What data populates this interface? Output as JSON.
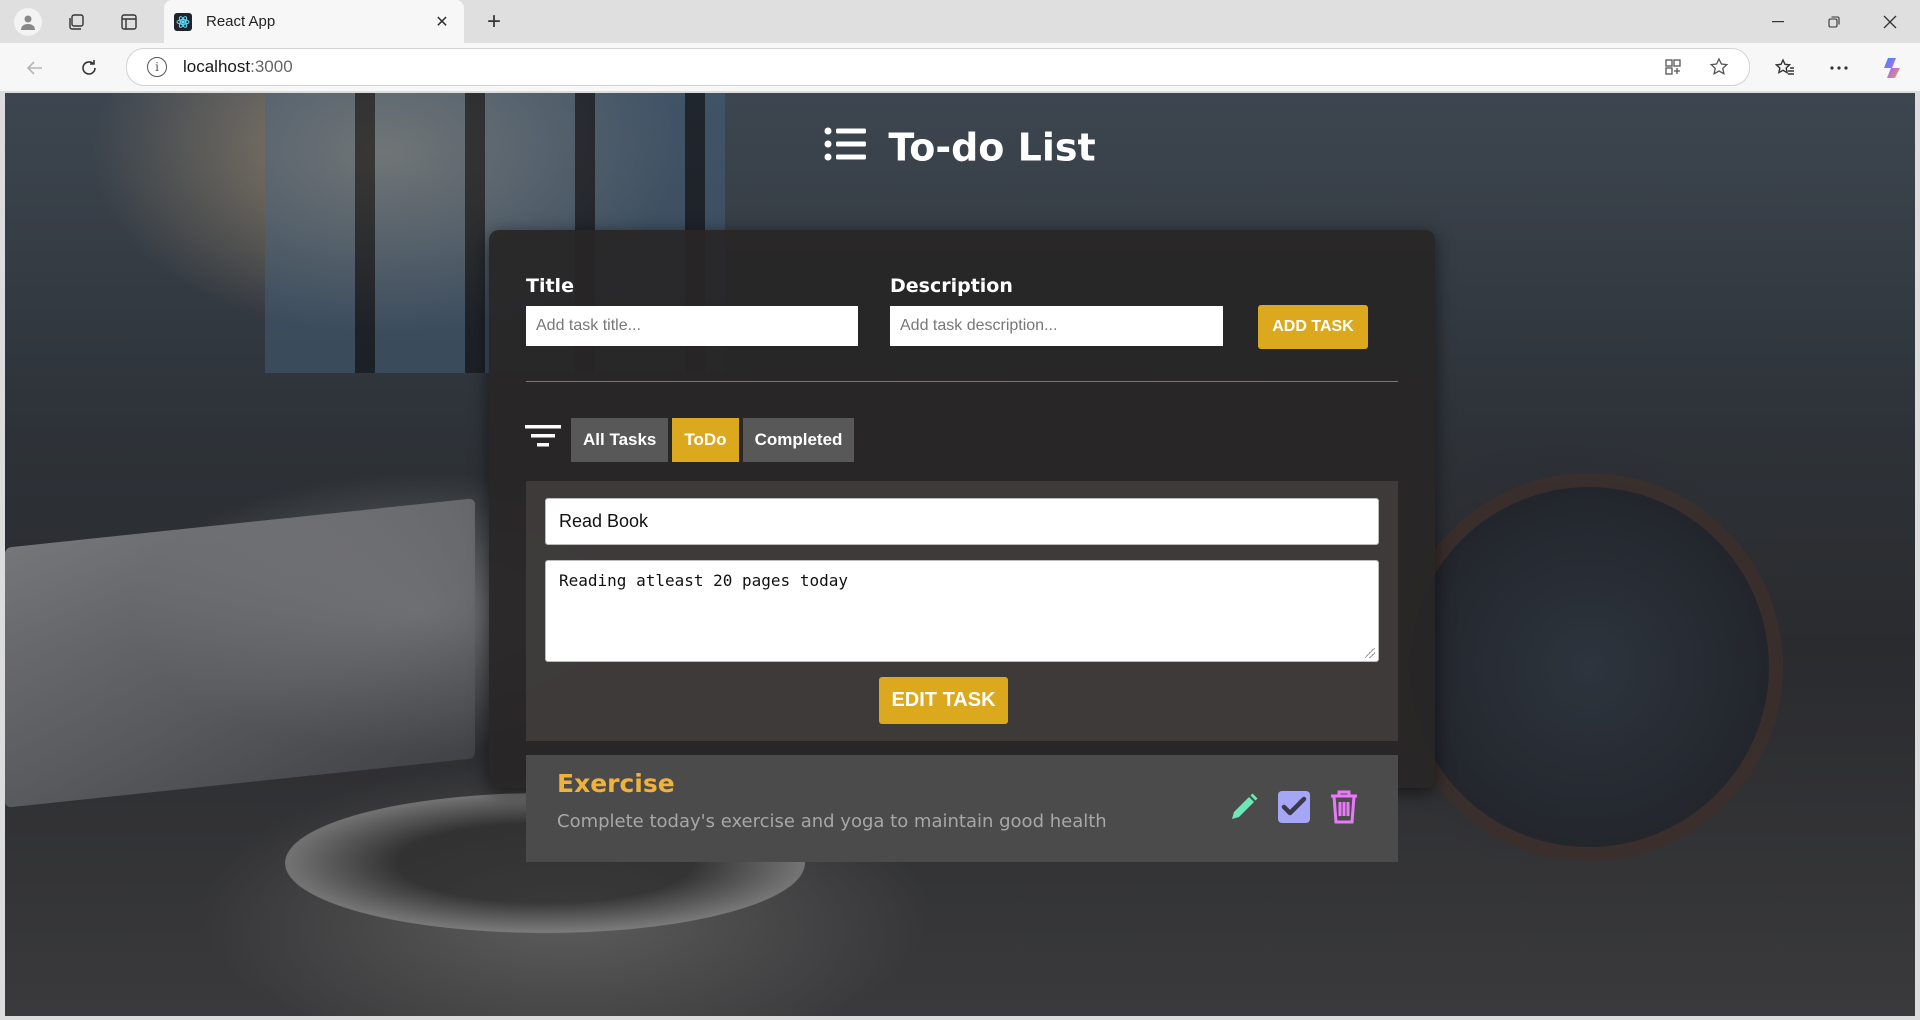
{
  "browser": {
    "tab_title": "React App",
    "url_host": "localhost",
    "url_port": ":3000"
  },
  "app": {
    "title": "To-do List"
  },
  "form": {
    "title_label": "Title",
    "title_placeholder": "Add task title...",
    "description_label": "Description",
    "description_placeholder": "Add task description...",
    "add_button": "ADD TASK"
  },
  "filters": {
    "tabs": [
      {
        "label": "All Tasks",
        "active": false
      },
      {
        "label": "ToDo",
        "active": true
      },
      {
        "label": "Completed",
        "active": false
      }
    ]
  },
  "editing": {
    "title_value": "Read Book",
    "description_value": "Reading atleast 20 pages today",
    "edit_button": "EDIT TASK"
  },
  "tasks": [
    {
      "title": "Exercise",
      "description": "Complete today's exercise and yoga to maintain good health",
      "icons": [
        "edit-icon",
        "check-icon",
        "delete-icon"
      ]
    }
  ],
  "colors": {
    "accent": "#dba81e",
    "task_title": "#f1b23b",
    "edit_icon": "#6ee7b7",
    "check_icon": "#a5a6f6",
    "delete_icon": "#e879f9"
  }
}
